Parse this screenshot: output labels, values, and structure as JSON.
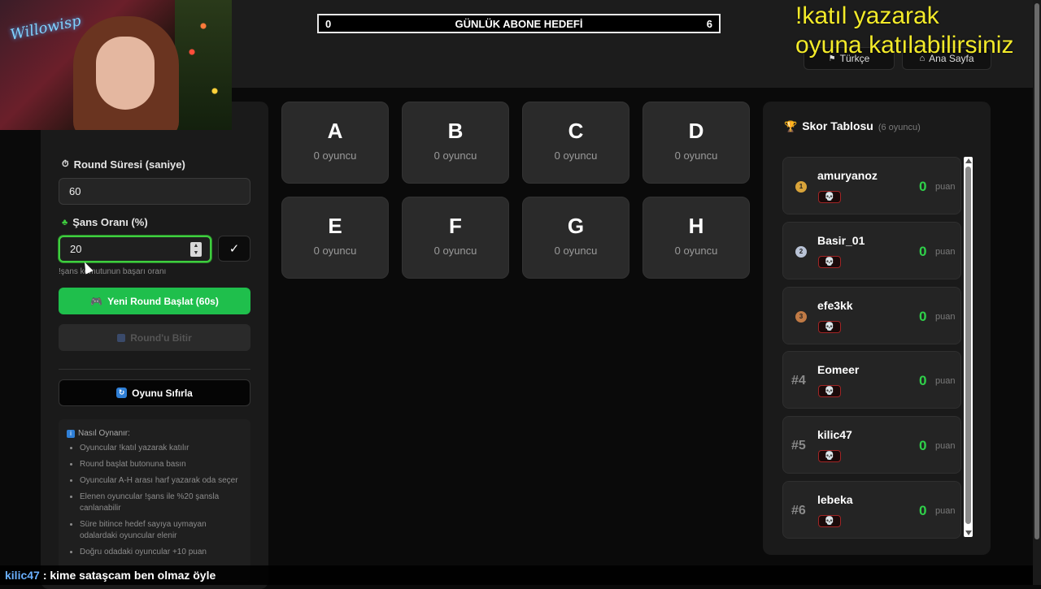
{
  "header": {
    "goal": {
      "current": "0",
      "label": "GÜNLÜK ABONE HEDEFİ",
      "target": "6"
    },
    "language_button": "Türkçe",
    "home_button": "Ana Sayfa"
  },
  "overlay": {
    "line1": "!katıl yazarak",
    "line2": "oyuna katılabilirsiniz"
  },
  "webcam": {
    "logo": "Willowisp"
  },
  "controls": {
    "round_time_label": "Round Süresi (saniye)",
    "round_time_value": "60",
    "chance_label": "Şans Oranı (%)",
    "chance_value": "20",
    "confirm_label": "✓",
    "chance_hint": "!şans komutunun başarı oranı",
    "start_button": "Yeni Round Başlat (60s)",
    "end_button": "Round'u Bitir",
    "reset_button": "Oyunu Sıfırla",
    "howto_title": "Nasıl Oynanır:",
    "howto_items": [
      "Oyuncular !katıl yazarak katılır",
      "Round başlat butonuna basın",
      "Oyuncular A-H arası harf yazarak oda seçer",
      "Elenen oyuncular !şans ile %20 şansla canlanabilir",
      "Süre bitince hedef sayıya uymayan odalardaki oyuncular elenir",
      "Doğru odadaki oyuncular +10 puan"
    ]
  },
  "rooms": [
    {
      "letter": "A",
      "count": "0 oyuncu"
    },
    {
      "letter": "B",
      "count": "0 oyuncu"
    },
    {
      "letter": "C",
      "count": "0 oyuncu"
    },
    {
      "letter": "D",
      "count": "0 oyuncu"
    },
    {
      "letter": "E",
      "count": "0 oyuncu"
    },
    {
      "letter": "F",
      "count": "0 oyuncu"
    },
    {
      "letter": "G",
      "count": "0 oyuncu"
    },
    {
      "letter": "H",
      "count": "0 oyuncu"
    }
  ],
  "scoreboard": {
    "title": "Skor Tablosu",
    "subtitle": "(6 oyuncu)",
    "unit": "puan",
    "players": [
      {
        "rank": "1",
        "name": "amuryanoz",
        "score": "0",
        "medal_color": "#d9a43a"
      },
      {
        "rank": "2",
        "name": "Basir_01",
        "score": "0",
        "medal_color": "#b9c3d6"
      },
      {
        "rank": "3",
        "name": "efe3kk",
        "score": "0",
        "medal_color": "#c07a45"
      },
      {
        "rank": "#4",
        "name": "Eomeer",
        "score": "0"
      },
      {
        "rank": "#5",
        "name": "kilic47",
        "score": "0"
      },
      {
        "rank": "#6",
        "name": "lebeka",
        "score": "0"
      }
    ]
  },
  "chat": {
    "user": "kilic47",
    "message": ": kime sataşcam ben olmaz öyle"
  },
  "colors": {
    "accent_green": "#1fbf4c",
    "score_green": "#2fd14a",
    "overlay_yellow": "#f3ea2a"
  }
}
